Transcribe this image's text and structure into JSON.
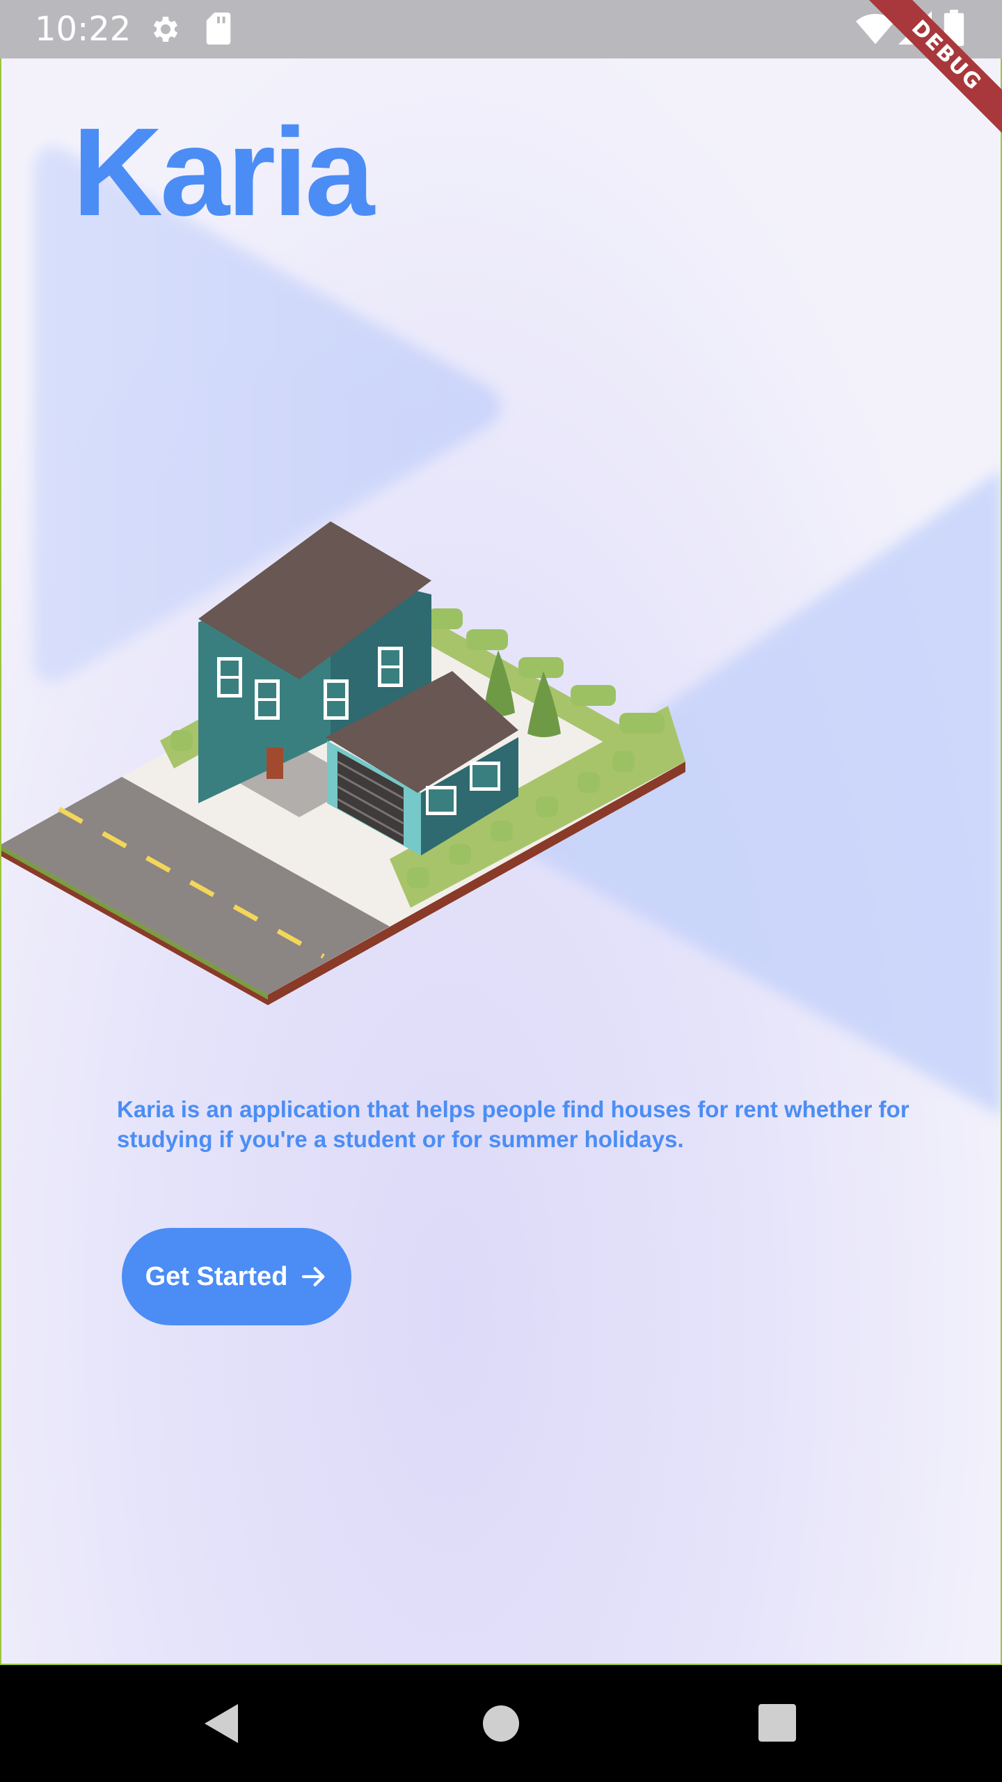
{
  "status_bar": {
    "time": "10:22",
    "icons": [
      "gear-icon",
      "sd-card-icon",
      "wifi-icon",
      "signal-icon",
      "battery-icon"
    ]
  },
  "debug_banner": "DEBUG",
  "app": {
    "title": "Karia",
    "description": "Karia is an application that helps people find houses for rent whether for studying if you're a student or for summer holidays.",
    "cta_label": "Get Started",
    "cta_icon": "arrow-right-icon"
  },
  "nav_bar": {
    "icons": [
      "back-icon",
      "home-icon",
      "recents-icon"
    ]
  },
  "colors": {
    "accent": "#4b8df5",
    "status_bar": "#b9b8bd",
    "debug_ribbon": "#a8383b",
    "nav_bar": "#000000"
  }
}
